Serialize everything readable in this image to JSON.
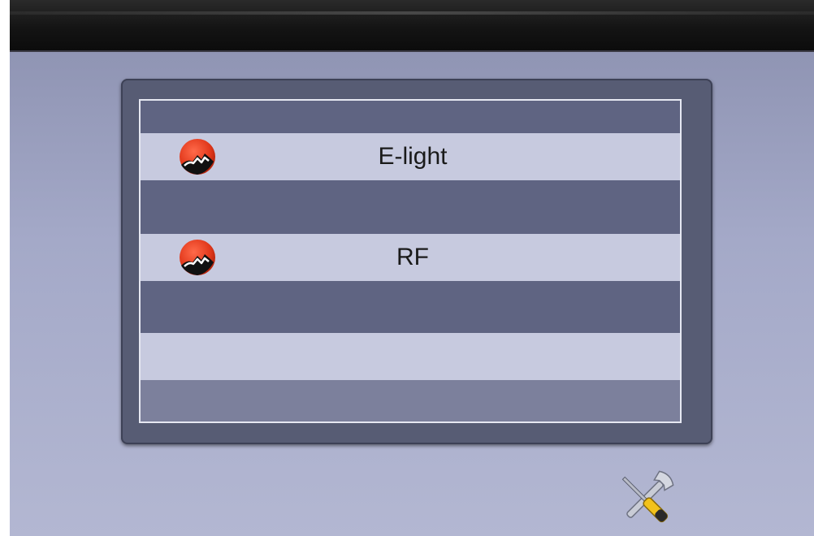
{
  "menu": {
    "items": [
      {
        "label": "E-light",
        "icon": "laser-logo-icon"
      },
      {
        "label": "RF",
        "icon": "laser-logo-icon"
      }
    ]
  },
  "toolbar": {
    "settings_icon": "tools-icon"
  },
  "colors": {
    "panel": "#575c74",
    "row_dark": "#5f6482",
    "row_light": "#c7cadf",
    "icon_red": "#e2391c"
  }
}
